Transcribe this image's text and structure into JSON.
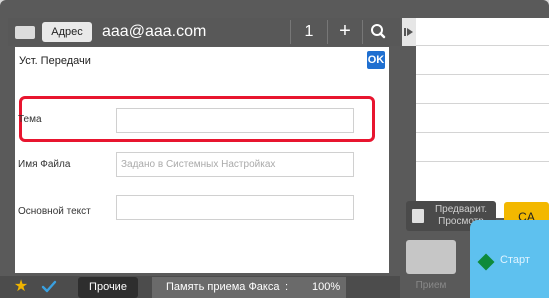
{
  "topbar": {
    "address_button": "Адрес",
    "address_value": "aaa@aaa.com",
    "count": "1",
    "plus": "+"
  },
  "dialog": {
    "title": "Уст. Передачи",
    "ok_label": "OK",
    "fields": [
      {
        "label": "Тема",
        "colon": ":",
        "value": "",
        "placeholder": ""
      },
      {
        "label": "Имя Файла",
        "colon": ":",
        "value": "",
        "placeholder": "Задано в Системных Настройках"
      },
      {
        "label": "Основной текст",
        "colon": ":",
        "value": "",
        "placeholder": ""
      }
    ]
  },
  "right": {
    "preview_label": "Предварит.\nПросмотр",
    "ca_label": "CA",
    "receive_label": "Прием",
    "start_label": "Старт"
  },
  "bottombar": {
    "star": "★",
    "other_label": "Прочие",
    "fax_memory_label": "Память приема Факса",
    "fax_memory_colon": ":",
    "fax_memory_value": "100%"
  },
  "colors": {
    "highlight": "#e8152f",
    "ok": "#1f6fd0",
    "ca": "#f3b800",
    "start": "#5ec1ef",
    "start_icon": "#0e8a3b",
    "check": "#3aa0e0"
  }
}
